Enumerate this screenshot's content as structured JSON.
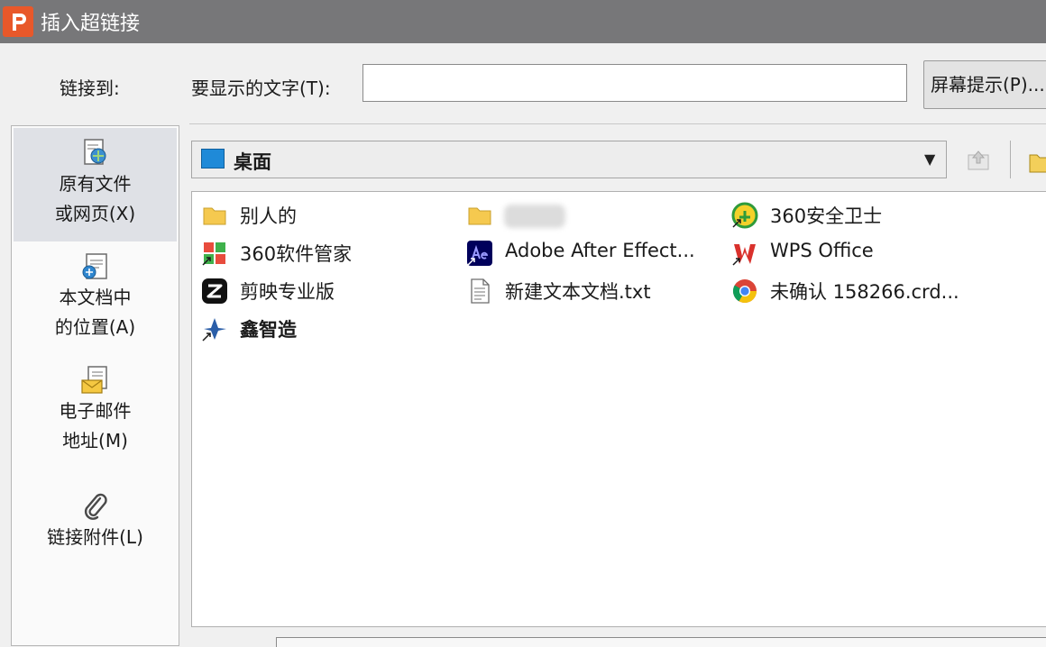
{
  "window": {
    "title": "插入超链接",
    "app_icon_letter": "P",
    "accent": "#e8582a"
  },
  "header": {
    "link_to_label": "链接到:",
    "display_text_label": "要显示的文字(T):",
    "display_text_value": "",
    "screentip_label": "屏幕提示(P)..."
  },
  "sidebar": {
    "items": [
      {
        "label_line1": "原有文件",
        "label_line2": "或网页(X)",
        "icon": "existing-file-icon",
        "selected": true
      },
      {
        "label_line1": "本文档中",
        "label_line2": "的位置(A)",
        "icon": "document-place-icon",
        "selected": false
      },
      {
        "label_line1": "电子邮件",
        "label_line2": "地址(M)",
        "icon": "email-icon",
        "selected": false
      },
      {
        "label_line1": "链接附件(L)",
        "label_line2": "",
        "icon": "paperclip-icon",
        "selected": false
      }
    ]
  },
  "location": {
    "current": "桌面",
    "icon": "desktop-icon"
  },
  "files": [
    {
      "name": "别人的",
      "icon": "folder-icon"
    },
    {
      "name": "",
      "icon": "folder-icon"
    },
    {
      "name": "360安全卫士",
      "icon": "360-security-icon"
    },
    {
      "name": "360软件管家",
      "icon": "360-software-manager-icon"
    },
    {
      "name": "Adobe After Effect...",
      "icon": "after-effects-icon"
    },
    {
      "name": "WPS Office",
      "icon": "wps-office-icon"
    },
    {
      "name": "剪映专业版",
      "icon": "jianying-icon"
    },
    {
      "name": "新建文本文档.txt",
      "icon": "text-file-icon"
    },
    {
      "name": "未确认 158266.crd...",
      "icon": "chrome-icon"
    },
    {
      "name": "鑫智造",
      "icon": "xinzhizao-icon"
    }
  ]
}
